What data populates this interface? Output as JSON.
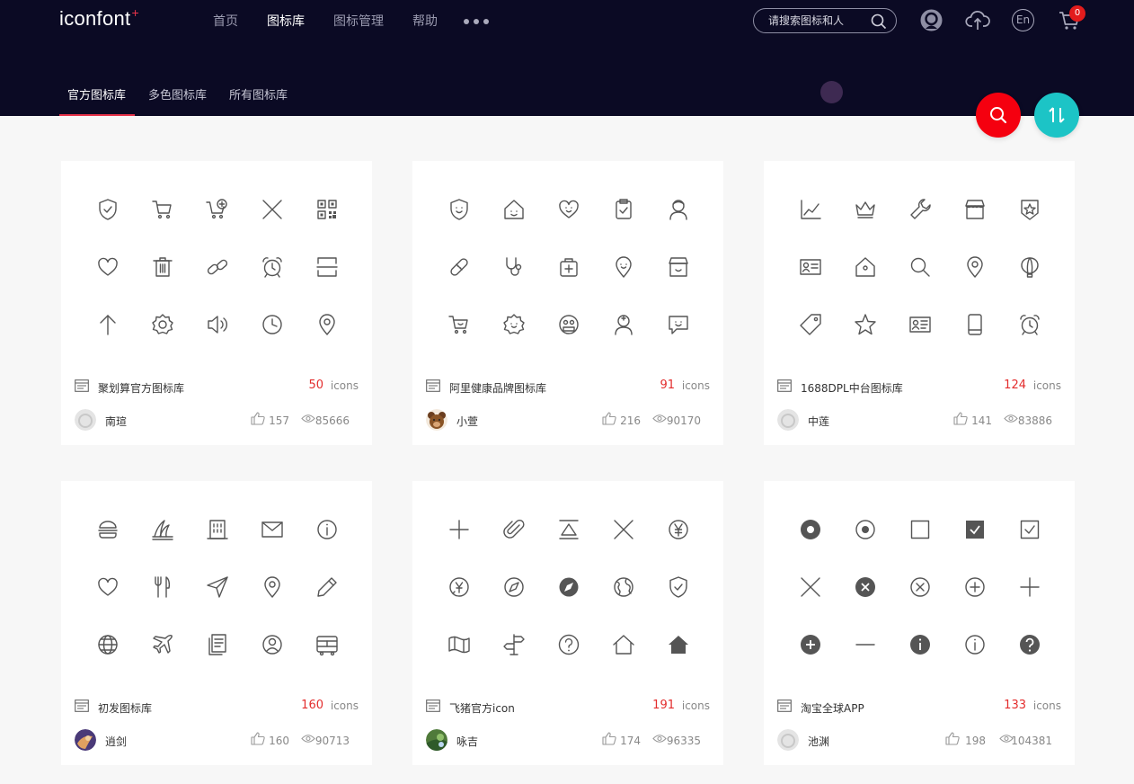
{
  "header": {
    "logo_text": "iconfont",
    "logo_mark": "+",
    "nav": [
      "首页",
      "图标库",
      "图标管理",
      "帮助"
    ],
    "nav_active": 1,
    "search_placeholder": "请搜索图标和人",
    "cart_count": "0",
    "lang_label": "En"
  },
  "tabs": [
    "官方图标库",
    "多色图标库",
    "所有图标库"
  ],
  "colors": {
    "brand": "#e8334a",
    "header_bg": "#0b0a24",
    "count_red": "#e32d2d",
    "fab_red": "#f5000f",
    "fab_teal": "#1cc4c6"
  },
  "icons_unit": "icons",
  "cards": [
    {
      "name": "聚划算官方图标库",
      "count": "50",
      "author": "南瑄",
      "likes": "157",
      "views": "85666",
      "icons": [
        "shield-check-icon",
        "shopping-cart-icon",
        "cart-add-icon",
        "close-icon",
        "qrcode-icon",
        "heart-icon",
        "trash-icon",
        "link-icon",
        "alarm-clock-icon",
        "scan-icon",
        "arrow-up-icon",
        "settings-icon",
        "volume-icon",
        "clock-icon",
        "location-icon"
      ]
    },
    {
      "name": "阿里健康品牌图标库",
      "count": "91",
      "author": "小萱",
      "likes": "216",
      "views": "90170",
      "icons": [
        "shield-face-icon",
        "home-face-icon",
        "heart-face-icon",
        "clipboard-check-icon",
        "doctor-icon",
        "bandage-icon",
        "stethoscope-icon",
        "medicine-bag-icon",
        "location-face-icon",
        "store-icon",
        "cart-face-icon",
        "gear-face-icon",
        "mask-face-icon",
        "nurse-icon",
        "chat-face-icon"
      ]
    },
    {
      "name": "1688DPL中台图标库",
      "count": "124",
      "author": "中莲",
      "likes": "141",
      "views": "83886",
      "icons": [
        "line-chart-icon",
        "crown-icon",
        "wrench-icon",
        "shop-icon",
        "badge-star-icon",
        "id-card-icon",
        "house-icon",
        "search-icon",
        "location-icon",
        "balloon-icon",
        "tag-icon",
        "star-icon",
        "contact-card-icon",
        "tablet-icon",
        "alarm-clock-icon"
      ]
    },
    {
      "name": "初发图标库",
      "count": "160",
      "author": "逍剑",
      "likes": "160",
      "views": "90713",
      "icons": [
        "burger-icon",
        "opera-house-icon",
        "building-icon",
        "mail-icon",
        "info-icon",
        "heart-icon",
        "cutlery-icon",
        "send-icon",
        "location-icon",
        "pencil-icon",
        "globe-icon",
        "airplane-icon",
        "documents-icon",
        "user-circle-icon",
        "bus-icon"
      ]
    },
    {
      "name": "飞猪官方icon",
      "count": "191",
      "author": "咏吉",
      "likes": "174",
      "views": "96335",
      "icons": [
        "plus-icon",
        "paperclip-icon",
        "top-align-icon",
        "close-icon",
        "yen-circle-icon",
        "yen-compass-icon",
        "compass-icon",
        "compass-filled-icon",
        "globe-earth-icon",
        "shield-check-icon",
        "map-icon",
        "signpost-icon",
        "question-circle-icon",
        "home-icon",
        "home-filled-icon"
      ]
    },
    {
      "name": "淘宝全球APP",
      "count": "133",
      "author": "池渊",
      "likes": "198",
      "views": "104381",
      "icons": [
        "radio-filled-icon",
        "radio-icon",
        "checkbox-empty-icon",
        "checkbox-checked-filled-icon",
        "checkbox-checked-icon",
        "close-icon",
        "close-circle-filled-icon",
        "close-circle-icon",
        "plus-circle-icon",
        "plus-icon",
        "plus-circle-filled-icon",
        "minus-icon",
        "info-filled-icon",
        "info-icon",
        "question-filled-icon"
      ]
    }
  ]
}
